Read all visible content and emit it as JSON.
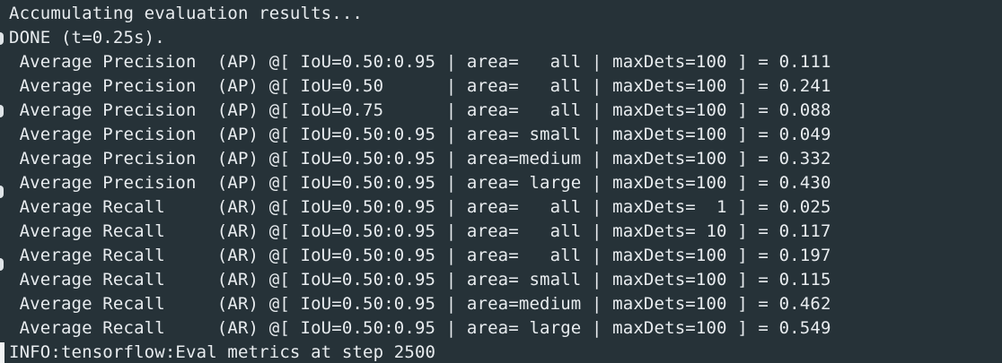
{
  "terminal": {
    "lines": [
      "Accumulating evaluation results...",
      "DONE (t=0.25s).",
      " Average Precision  (AP) @[ IoU=0.50:0.95 | area=   all | maxDets=100 ] = 0.111",
      " Average Precision  (AP) @[ IoU=0.50      | area=   all | maxDets=100 ] = 0.241",
      " Average Precision  (AP) @[ IoU=0.75      | area=   all | maxDets=100 ] = 0.088",
      " Average Precision  (AP) @[ IoU=0.50:0.95 | area= small | maxDets=100 ] = 0.049",
      " Average Precision  (AP) @[ IoU=0.50:0.95 | area=medium | maxDets=100 ] = 0.332",
      " Average Precision  (AP) @[ IoU=0.50:0.95 | area= large | maxDets=100 ] = 0.430",
      " Average Recall     (AR) @[ IoU=0.50:0.95 | area=   all | maxDets=  1 ] = 0.025",
      " Average Recall     (AR) @[ IoU=0.50:0.95 | area=   all | maxDets= 10 ] = 0.117",
      " Average Recall     (AR) @[ IoU=0.50:0.95 | area=   all | maxDets=100 ] = 0.197",
      " Average Recall     (AR) @[ IoU=0.50:0.95 | area= small | maxDets=100 ] = 0.115",
      " Average Recall     (AR) @[ IoU=0.50:0.95 | area=medium | maxDets=100 ] = 0.462",
      " Average Recall     (AR) @[ IoU=0.50:0.95 | area= large | maxDets=100 ] = 0.549",
      "INFO:tensorflow:Eval metrics at step 2500"
    ]
  },
  "colors": {
    "background": "#263238",
    "text": "#e8ecef"
  }
}
